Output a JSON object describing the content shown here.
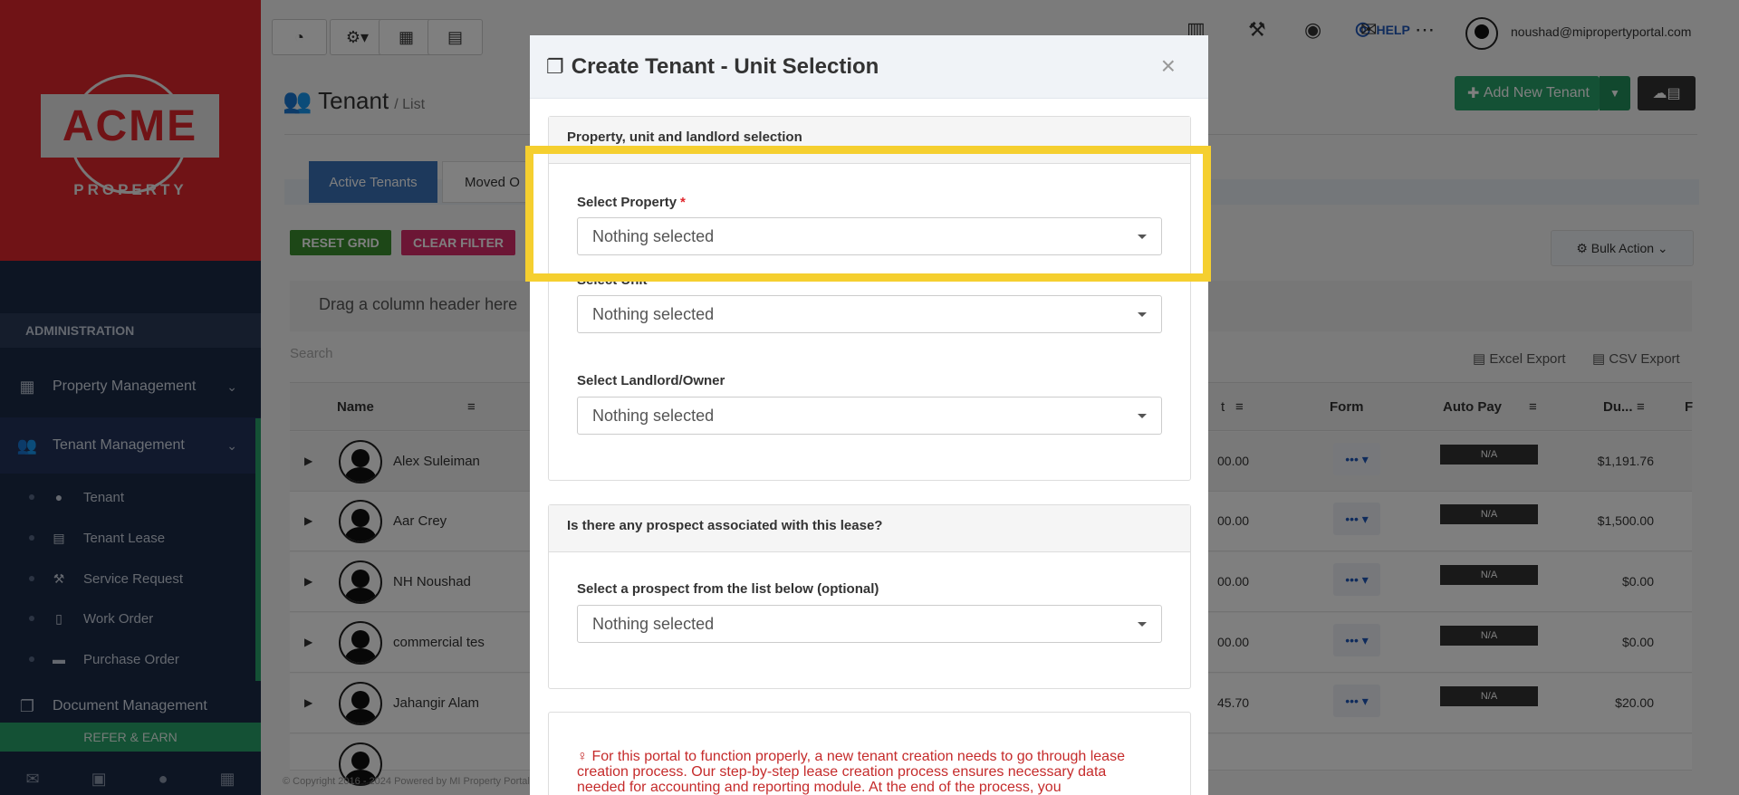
{
  "sidebar": {
    "logo_text": "ACME",
    "logo_sub": "PROPERTY",
    "admin_label": "ADMINISTRATION",
    "items": [
      {
        "label": "Property Management",
        "icon": "building-icon"
      },
      {
        "label": "Tenant Management",
        "icon": "users-icon"
      }
    ],
    "sub_items": [
      {
        "label": "Tenant",
        "icon": "user-icon"
      },
      {
        "label": "Tenant Lease",
        "icon": "calendar-icon"
      },
      {
        "label": "Service Request",
        "icon": "wrench-icon"
      },
      {
        "label": "Work Order",
        "icon": "file-icon"
      },
      {
        "label": "Purchase Order",
        "icon": "truck-icon"
      }
    ],
    "document_management": "Document Management",
    "refer_earn": "REFER & EARN"
  },
  "topbar": {
    "help": "HELP",
    "user_email": "noushad@mipropertyportal.com"
  },
  "page": {
    "title": "Tenant",
    "subtitle": "/ List",
    "add_new_tenant": "Add New Tenant",
    "tabs": [
      "Active Tenants",
      "Moved O"
    ],
    "reset_grid": "RESET GRID",
    "clear_filter": "CLEAR FILTER",
    "bulk_action": "Bulk Action",
    "group_hint": "Drag a column header here",
    "search_placeholder": "Search",
    "excel_export": "Excel Export",
    "csv_export": "CSV Export",
    "footer": "© Copyright 2016 - 2024 Powered by MI Property Portal"
  },
  "grid": {
    "columns": {
      "name": "Name",
      "amount": "t",
      "form": "Form",
      "auto_pay": "Auto Pay",
      "due": "Du...",
      "extra": "F"
    },
    "rows": [
      {
        "name": "Alex Suleiman",
        "amount": "00.00",
        "autopay": "N/A",
        "due": "$1,191.76"
      },
      {
        "name": "Aar Crey",
        "amount": "00.00",
        "autopay": "N/A",
        "due": "$1,500.00"
      },
      {
        "name": "NH Noushad",
        "amount": "00.00",
        "autopay": "N/A",
        "due": "$0.00"
      },
      {
        "name": "commercial tes",
        "amount": "00.00",
        "autopay": "N/A",
        "due": "$0.00"
      },
      {
        "name": "Jahangir Alam",
        "amount": "45.70",
        "autopay": "N/A",
        "due": "$20.00"
      }
    ]
  },
  "modal": {
    "title": "Create Tenant - Unit Selection",
    "close": "×",
    "panel1_title": "Property, unit and landlord selection",
    "select_property_label": "Select Property",
    "required_mark": "*",
    "select_unit_label": "Select Unit",
    "select_landlord_label": "Select Landlord/Owner",
    "placeholder": "Nothing selected",
    "panel2_title": "Is there any prospect associated with this lease?",
    "select_prospect_label": "Select a prospect from the list below (optional)",
    "notice": "For this portal to function properly, a new tenant creation needs to go through lease creation process. Our step-by-step lease creation process ensures necessary data needed for accounting and reporting module. At the end of the process, you"
  },
  "colors": {
    "brand_red": "#e0262c",
    "sidebar": "#1b2a47",
    "accent_green": "#28a36a",
    "highlight": "#f5cf2f"
  }
}
